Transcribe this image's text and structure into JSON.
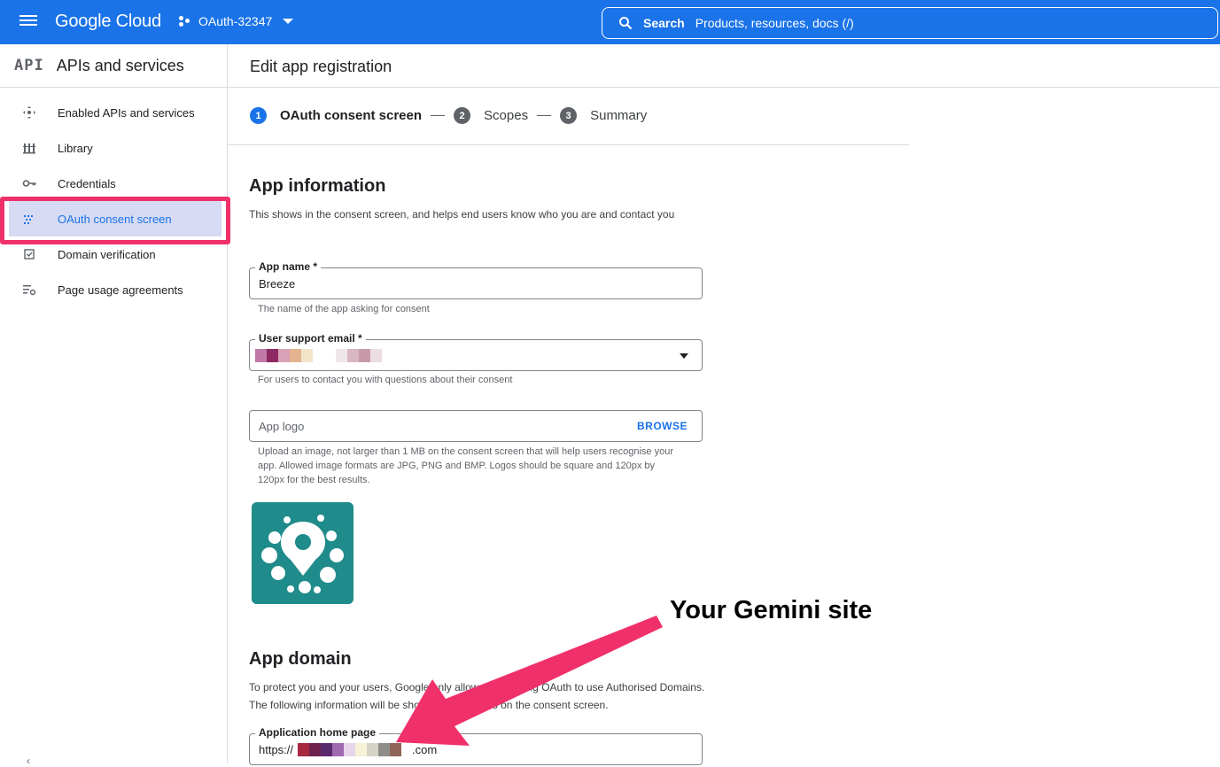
{
  "topbar": {
    "menu_icon": "hamburger-menu-icon",
    "brand": "Google Cloud",
    "project": "OAuth-32347",
    "search_keyword": "Search",
    "search_placeholder": "Products, resources, docs (/)"
  },
  "sidebar": {
    "mark": "API",
    "title": "APIs and services",
    "items": [
      {
        "label": "Enabled APIs and services",
        "icon": "enabled-apis-icon"
      },
      {
        "label": "Library",
        "icon": "library-icon"
      },
      {
        "label": "Credentials",
        "icon": "key-icon"
      },
      {
        "label": "OAuth consent screen",
        "icon": "consent-screen-icon",
        "active": true
      },
      {
        "label": "Domain verification",
        "icon": "checkbox-icon"
      },
      {
        "label": "Page usage agreements",
        "icon": "settings-list-icon"
      }
    ]
  },
  "main": {
    "page_title": "Edit app registration",
    "steps": [
      {
        "num": "1",
        "label": "OAuth consent screen"
      },
      {
        "num": "2",
        "label": "Scopes"
      },
      {
        "num": "3",
        "label": "Summary"
      }
    ],
    "app_info": {
      "title": "App information",
      "description": "This shows in the consent screen, and helps end users know who you are and contact you",
      "app_name_label": "App name *",
      "app_name_value": "Breeze",
      "app_name_hint": "The name of the app asking for consent",
      "support_email_label": "User support email *",
      "support_email_hint": "For users to contact you with questions about their consent",
      "logo_placeholder": "App logo",
      "browse_label": "BROWSE",
      "logo_hint": "Upload an image, not larger than 1 MB on the consent screen that will help users recognise your app. Allowed image formats are JPG, PNG and BMP. Logos should be square and 120px by 120px for the best results."
    },
    "app_domain": {
      "title": "App domain",
      "description": "To protect you and your users, Google only allows apps using OAuth to use Authorised Domains. The following information will be shown to your users on the consent screen.",
      "home_page_label": "Application home page",
      "home_page_prefix": "https://",
      "home_page_suffix": ".com"
    }
  },
  "annotation": {
    "text": "Your Gemini site",
    "color": "#f0306a"
  },
  "colors": {
    "brand_blue": "#1a73e8",
    "highlight": "#f0306a",
    "active_bg": "#d6dbf3"
  }
}
